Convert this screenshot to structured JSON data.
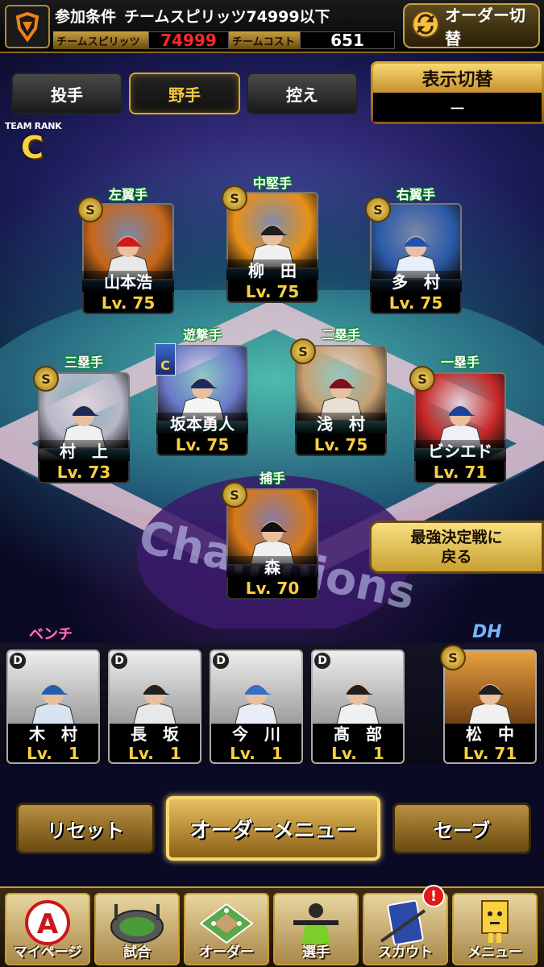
{
  "header": {
    "cond_label": "参加条件",
    "cond_value": "チームスピリッツ74999以下",
    "spirits_label": "チームスピリッツ",
    "spirits_value": "74999",
    "cost_label": "チームコスト",
    "cost_value": "651",
    "order_switch_label": "オーダー切替",
    "team_logo_icon": "giants-logo-icon"
  },
  "tabs": [
    {
      "label": "投手",
      "active": false
    },
    {
      "label": "野手",
      "active": true
    },
    {
      "label": "控え",
      "active": false
    }
  ],
  "display_switch": {
    "title": "表示切替",
    "value": "ー"
  },
  "team_rank": {
    "label": "TEAM RANK",
    "value": "C"
  },
  "fielders": [
    {
      "position": "左翼手",
      "name": "山本浩",
      "level": "Lv. 75",
      "badge": "S",
      "bg": "#c8661a",
      "uniform": "#e8e8e8",
      "cap": "#d01818"
    },
    {
      "position": "中堅手",
      "name": "柳　田",
      "level": "Lv. 75",
      "badge": "S",
      "bg": "#e89018",
      "uniform": "#f0f0f0",
      "cap": "#202020"
    },
    {
      "position": "右翼手",
      "name": "多　村",
      "level": "Lv. 75",
      "badge": "S",
      "bg": "#2a5aa8",
      "uniform": "#e8eef8",
      "cap": "#2050b0"
    },
    {
      "position": "三塁手",
      "name": "村　上",
      "level": "Lv. 73",
      "badge": "S",
      "bg": "#b8b8c8",
      "uniform": "#f0f0f0",
      "cap": "#1a2a5a"
    },
    {
      "position": "遊撃手",
      "name": "坂本勇人",
      "level": "Lv. 75",
      "badge": "C",
      "bg": "#6a7ac8",
      "uniform": "#f4f4f4",
      "cap": "#1a2a5a"
    },
    {
      "position": "二塁手",
      "name": "浅　村",
      "level": "Lv. 75",
      "badge": "S",
      "bg": "#c8a070",
      "uniform": "#e8e0d0",
      "cap": "#7a1020"
    },
    {
      "position": "一塁手",
      "name": "ビシエド",
      "level": "Lv. 71",
      "badge": "S",
      "bg": "#c82828",
      "uniform": "#f0f0f8",
      "cap": "#1a40a0"
    },
    {
      "position": "捕手",
      "name": "森",
      "level": "Lv. 70",
      "badge": "S",
      "bg": "#d87818",
      "uniform": "#f0f0f0",
      "cap": "#101010"
    }
  ],
  "back_button": {
    "line1": "最強決定戦に",
    "line2": "戻る"
  },
  "bench": {
    "label": "ベンチ",
    "players": [
      {
        "name": "木　村",
        "level": "Lv.　1",
        "badge": "D",
        "uniform": "#d8e4f0",
        "cap": "#2060b0"
      },
      {
        "name": "長　坂",
        "level": "Lv.　1",
        "badge": "D",
        "uniform": "#e8e8e8",
        "cap": "#202020"
      },
      {
        "name": "今　川",
        "level": "Lv.　1",
        "badge": "D",
        "uniform": "#e8eef8",
        "cap": "#3070c8"
      },
      {
        "name": "髙　部",
        "level": "Lv.　1",
        "badge": "D",
        "uniform": "#f0f0f0",
        "cap": "#202020"
      }
    ]
  },
  "dh": {
    "label": "DH",
    "name": "松　中",
    "level": "Lv. 71",
    "badge": "S",
    "uniform": "#f0f0f0",
    "cap": "#202020"
  },
  "buttons": {
    "reset": "リセット",
    "order_menu": "オーダーメニュー",
    "save": "セーブ"
  },
  "nav": [
    {
      "label": "マイページ",
      "icon": "mypage-a-icon"
    },
    {
      "label": "試合",
      "icon": "stadium-icon"
    },
    {
      "label": "オーダー",
      "icon": "field-order-icon"
    },
    {
      "label": "選手",
      "icon": "player-icon"
    },
    {
      "label": "スカウト",
      "icon": "scout-card-icon"
    },
    {
      "label": "メニュー",
      "icon": "menu-mascot-icon"
    }
  ],
  "notification_badge": "!"
}
